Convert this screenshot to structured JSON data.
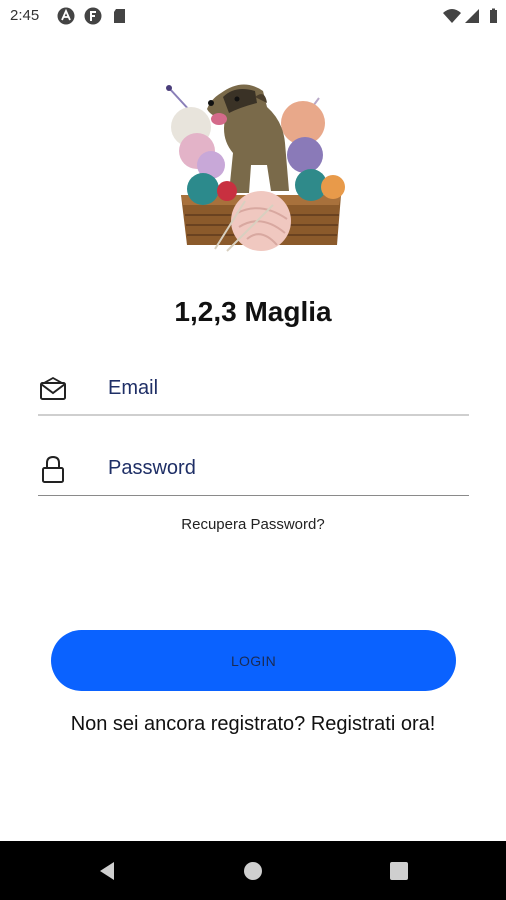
{
  "status_bar": {
    "time": "2:45",
    "left_icons": [
      "android-auto-icon",
      "f-notification-icon",
      "sd-card-icon"
    ],
    "right_icons": [
      "wifi-icon",
      "signal-icon",
      "battery-icon"
    ]
  },
  "app": {
    "title": "1,2,3 Maglia",
    "logo": "puppy-in-yarn-basket-logo"
  },
  "form": {
    "email_placeholder": "Email",
    "email_icon": "envelope-icon",
    "password_placeholder": "Password",
    "password_icon": "lock-icon",
    "recover_label": "Recupera Password?",
    "login_label": "LOGIN",
    "register_label": "Non sei ancora registrato? Registrati ora!"
  },
  "colors": {
    "primary": "#0a62ff",
    "background": "#ffffff",
    "nav_bar": "#000000"
  },
  "nav_bar": {
    "buttons": [
      "back-icon",
      "home-icon",
      "recents-icon"
    ]
  }
}
